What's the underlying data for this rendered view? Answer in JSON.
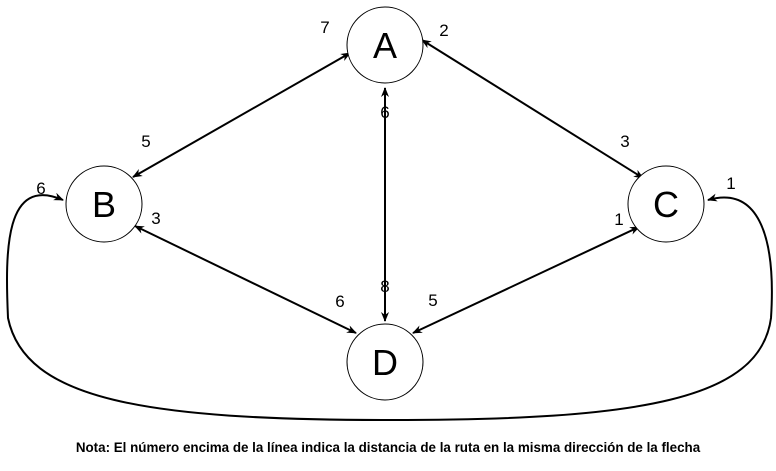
{
  "nodes": {
    "A": {
      "label": "A"
    },
    "B": {
      "label": "B"
    },
    "C": {
      "label": "C"
    },
    "D": {
      "label": "D"
    }
  },
  "edges": {
    "A_B": {
      "weight_near_A": "7",
      "weight_near_B": "5"
    },
    "A_C": {
      "weight_near_A": "2",
      "weight_near_C": "3"
    },
    "A_D": {
      "weight_near_A": "6",
      "weight_near_D": "8"
    },
    "B_D": {
      "weight_near_B": "3",
      "weight_near_D": "6"
    },
    "C_D": {
      "weight_near_C": "1",
      "weight_near_D": "5"
    },
    "B_C": {
      "weight_near_B": "6",
      "weight_near_C": "1"
    }
  },
  "note": "Nota: El número encima de la línea indica la distancia de la ruta en la misma dirección de la flecha",
  "colors": {
    "stroke": "#000000",
    "background": "#ffffff"
  }
}
